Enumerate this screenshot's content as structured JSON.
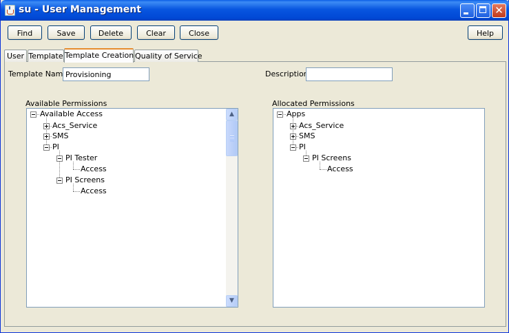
{
  "window": {
    "title": "su - User Management"
  },
  "toolbar": {
    "find": "Find",
    "save": "Save",
    "delete": "Delete",
    "clear": "Clear",
    "close": "Close",
    "help": "Help"
  },
  "tabs": {
    "user": "User",
    "template": "Template",
    "template_creation": "Template Creation",
    "quality_of_service": "Quality of Service",
    "active": "Template Creation"
  },
  "form": {
    "template_name_label": "Template Name",
    "template_name_value": "Provisioning",
    "description_label": "Description",
    "description_value": ""
  },
  "available": {
    "label": "Available Permissions",
    "tree": {
      "root": "Available Access",
      "acs_service": "Acs_Service",
      "sms": "SMS",
      "pi": "PI",
      "pi_tester": "PI Tester",
      "pi_tester_access": "Access",
      "pi_screens": "PI Screens",
      "pi_screens_access": "Access"
    }
  },
  "allocated": {
    "label": "Allocated Permissions",
    "tree": {
      "root": "Apps",
      "acs_service": "Acs_Service",
      "sms": "SMS",
      "pi": "PI",
      "pi_screens": "PI Screens",
      "pi_screens_access": "Access"
    }
  },
  "icons": {
    "window_icon": "java-coffee-cup-icon",
    "expanded": "tree-minus-icon",
    "collapsed": "tree-plus-icon",
    "scroll_up": "arrow-up-icon",
    "scroll_down": "arrow-down-icon"
  },
  "colors": {
    "titlebar": "#0054e3",
    "active_tab_accent": "#e68b2c",
    "window_bg": "#ece9d8"
  }
}
